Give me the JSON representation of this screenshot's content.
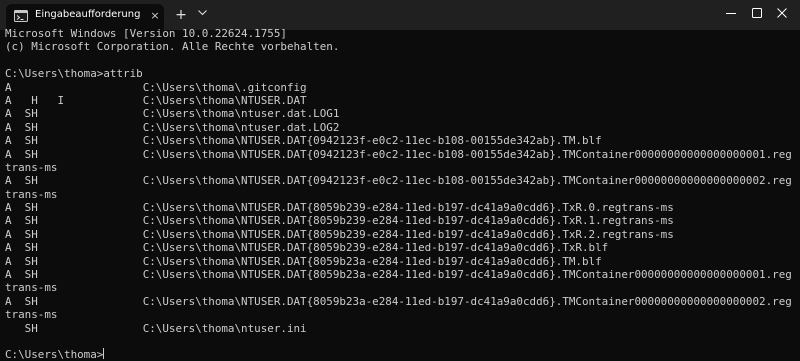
{
  "window": {
    "tab_title": "Eingabeaufforderung",
    "tab_close_icon": "×",
    "new_tab_icon": "+",
    "dropdown_icon": "⌄",
    "minimize_icon": "—",
    "maximize_icon": "☐",
    "close_icon": "✕"
  },
  "colors": {
    "background": "#0c0c0c",
    "titlebar": "#202020",
    "text": "#cccccc"
  },
  "terminal": {
    "lines": [
      "Microsoft Windows [Version 10.0.22624.1755]",
      "(c) Microsoft Corporation. Alle Rechte vorbehalten.",
      "",
      "C:\\Users\\thoma>attrib",
      "A                    C:\\Users\\thoma\\.gitconfig",
      "A   H   I            C:\\Users\\thoma\\NTUSER.DAT",
      "A  SH                C:\\Users\\thoma\\ntuser.dat.LOG1",
      "A  SH                C:\\Users\\thoma\\ntuser.dat.LOG2",
      "A  SH                C:\\Users\\thoma\\NTUSER.DAT{0942123f-e0c2-11ec-b108-00155de342ab}.TM.blf",
      "A  SH                C:\\Users\\thoma\\NTUSER.DAT{0942123f-e0c2-11ec-b108-00155de342ab}.TMContainer00000000000000000001.reg",
      "trans-ms",
      "A  SH                C:\\Users\\thoma\\NTUSER.DAT{0942123f-e0c2-11ec-b108-00155de342ab}.TMContainer00000000000000000002.reg",
      "trans-ms",
      "A  SH                C:\\Users\\thoma\\NTUSER.DAT{8059b239-e284-11ed-b197-dc41a9a0cdd6}.TxR.0.regtrans-ms",
      "A  SH                C:\\Users\\thoma\\NTUSER.DAT{8059b239-e284-11ed-b197-dc41a9a0cdd6}.TxR.1.regtrans-ms",
      "A  SH                C:\\Users\\thoma\\NTUSER.DAT{8059b239-e284-11ed-b197-dc41a9a0cdd6}.TxR.2.regtrans-ms",
      "A  SH                C:\\Users\\thoma\\NTUSER.DAT{8059b239-e284-11ed-b197-dc41a9a0cdd6}.TxR.blf",
      "A  SH                C:\\Users\\thoma\\NTUSER.DAT{8059b23a-e284-11ed-b197-dc41a9a0cdd6}.TM.blf",
      "A  SH                C:\\Users\\thoma\\NTUSER.DAT{8059b23a-e284-11ed-b197-dc41a9a0cdd6}.TMContainer00000000000000000001.reg",
      "trans-ms",
      "A  SH                C:\\Users\\thoma\\NTUSER.DAT{8059b23a-e284-11ed-b197-dc41a9a0cdd6}.TMContainer00000000000000000002.reg",
      "trans-ms",
      "   SH                C:\\Users\\thoma\\ntuser.ini",
      "",
      "C:\\Users\\thoma>"
    ]
  }
}
